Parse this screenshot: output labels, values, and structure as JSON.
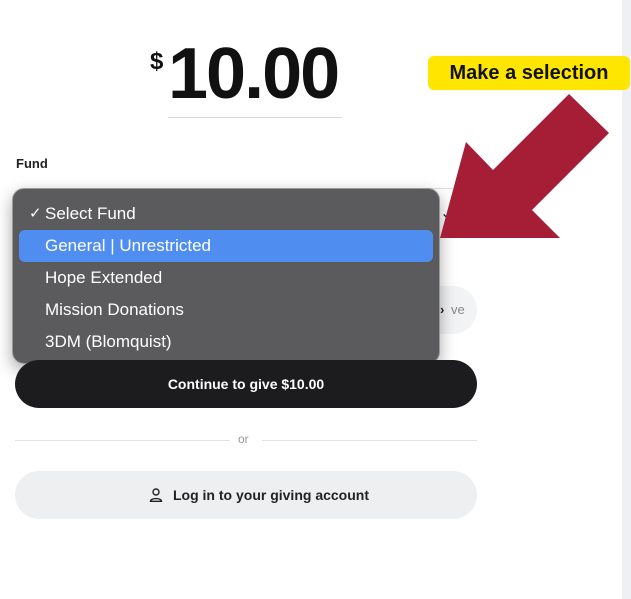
{
  "amount": {
    "currency": "$",
    "value": "10.00"
  },
  "callout": {
    "label": "Make a selection"
  },
  "fund": {
    "label": "Fund"
  },
  "dropdown": {
    "options": [
      {
        "label": "Select Fund",
        "checked": true
      },
      {
        "label": "General | Unrestricted",
        "highlighted": true
      },
      {
        "label": "Hope Extended"
      },
      {
        "label": "Mission Donations"
      },
      {
        "label": "3DM (Blomquist)"
      }
    ],
    "highlight_color": "#4f8ef0"
  },
  "frequency": {
    "visible_fragment": "ve"
  },
  "continue_button": {
    "label": "Continue to give $10.00"
  },
  "divider": {
    "or_label": "or"
  },
  "login_button": {
    "label": "Log in to your giving account",
    "icon": "person-icon"
  },
  "colors": {
    "arrow": "#a51e36",
    "callout_bg": "#ffe600",
    "primary_button": "#1c1c1e"
  }
}
